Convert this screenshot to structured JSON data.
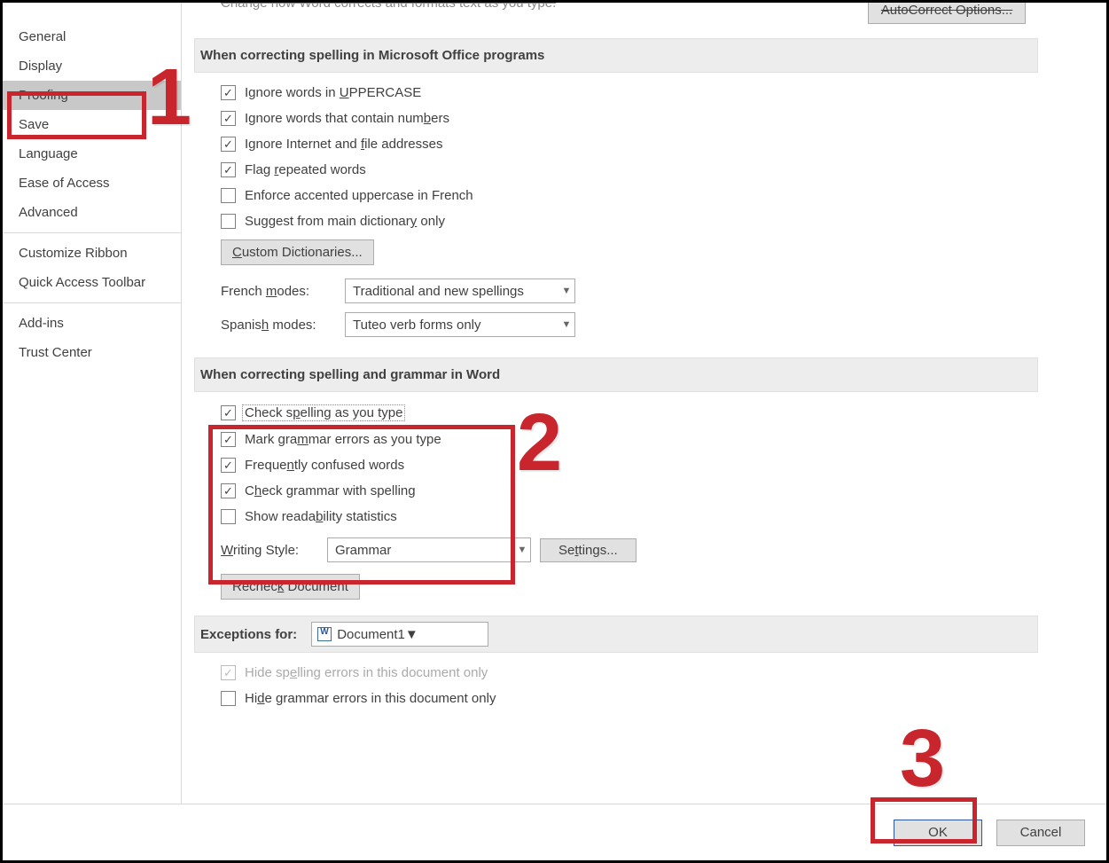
{
  "sidebar": {
    "items": [
      {
        "label": "General"
      },
      {
        "label": "Display"
      },
      {
        "label": "Proofing",
        "selected": true
      },
      {
        "label": "Save"
      },
      {
        "label": "Language"
      },
      {
        "label": "Ease of Access"
      },
      {
        "label": "Advanced"
      }
    ],
    "group2": [
      {
        "label": "Customize Ribbon"
      },
      {
        "label": "Quick Access Toolbar"
      }
    ],
    "group3": [
      {
        "label": "Add-ins"
      },
      {
        "label": "Trust Center"
      }
    ]
  },
  "cutoff": {
    "fragment": "Change how Word corrects and formats text as you type.",
    "button": "AutoCorrect Options..."
  },
  "section1": {
    "title": "When correcting spelling in Microsoft Office programs",
    "opt1_pre": "Ignore words in ",
    "opt1_u": "U",
    "opt1_post": "PPERCASE",
    "opt2_pre": "Ignore words that contain num",
    "opt2_u": "b",
    "opt2_post": "ers",
    "opt3_pre": "Ignore Internet and ",
    "opt3_u": "f",
    "opt3_post": "ile addresses",
    "opt4_pre": "Flag ",
    "opt4_u": "r",
    "opt4_post": "epeated words",
    "opt5": "Enforce accented uppercase in French",
    "opt6_pre": "Suggest from main dictionar",
    "opt6_u": "y",
    "opt6_post": " only",
    "custom_pre": "",
    "custom_u": "C",
    "custom_post": "ustom Dictionaries...",
    "french_lbl_pre": "French ",
    "french_lbl_u": "m",
    "french_lbl_post": "odes:",
    "french_value": "Traditional and new spellings",
    "spanish_lbl_pre": "Spanis",
    "spanish_lbl_u": "h",
    "spanish_lbl_post": " modes:",
    "spanish_value": "Tuteo verb forms only"
  },
  "section2": {
    "title": "When correcting spelling and grammar in Word",
    "opt1_pre": "Check s",
    "opt1_u": "p",
    "opt1_post": "elling as you type",
    "opt2_pre": "Mark gra",
    "opt2_u": "m",
    "opt2_post": "mar errors as you type",
    "opt3_pre": "Freque",
    "opt3_u": "n",
    "opt3_post": "tly confused words",
    "opt4_pre": "C",
    "opt4_u": "h",
    "opt4_post": "eck grammar with spelling",
    "opt5_pre": "Show reada",
    "opt5_u": "b",
    "opt5_post": "ility statistics",
    "wstyle_lbl_pre": "",
    "wstyle_lbl_u": "W",
    "wstyle_lbl_post": "riting Style:",
    "wstyle_value": "Grammar",
    "settings_pre": "Se",
    "settings_u": "t",
    "settings_post": "tings...",
    "recheck_pre": "Rechec",
    "recheck_u": "k",
    "recheck_post": " Document"
  },
  "exceptions": {
    "lbl_pre": "Exceptions for:",
    "lbl_u": "",
    "lbl_post": "",
    "combo_value": "Document1",
    "opt1_pre": "Hide sp",
    "opt1_u": "e",
    "opt1_post": "lling errors in this document only",
    "opt2_pre": "Hi",
    "opt2_u": "d",
    "opt2_post": "e grammar errors in this document only"
  },
  "footer": {
    "ok": "OK",
    "cancel": "Cancel"
  },
  "annotations": {
    "n1": "1",
    "n2": "2",
    "n3": "3"
  }
}
